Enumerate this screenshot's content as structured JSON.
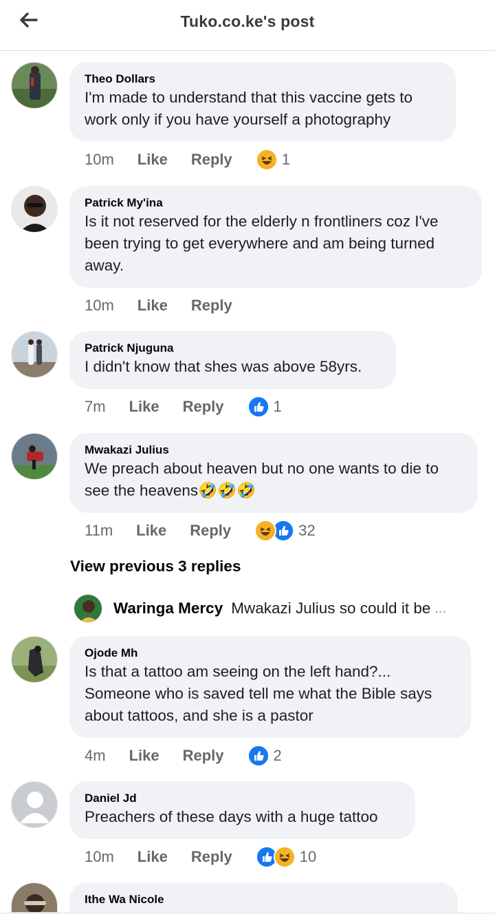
{
  "header": {
    "title": "Tuko.co.ke's post",
    "back_icon": "arrow-left-icon"
  },
  "comments": [
    {
      "author": "Theo Dollars",
      "lines": [
        "I'm made to understand that this vaccine gets to",
        "work only if you have yourself a photography"
      ],
      "time": "10m",
      "like": "Like",
      "reply": "Reply",
      "reactions": [
        "laughing-face-icon"
      ],
      "reaction_count": "1"
    },
    {
      "author": "Patrick My'ina",
      "lines": [
        "Is it not reserved for the elderly n frontliners coz I've",
        "been trying to get everywhere and am being turned",
        "away."
      ],
      "time": "10m",
      "like": "Like",
      "reply": "Reply",
      "reactions": [],
      "reaction_count": ""
    },
    {
      "author": "Patrick Njuguna",
      "lines": [
        "I didn't know that shes was above 58yrs."
      ],
      "time": "7m",
      "like": "Like",
      "reply": "Reply",
      "reactions": [
        "thumbs-up-icon"
      ],
      "reaction_count": "1"
    },
    {
      "author": "Mwakazi Julius",
      "lines": [
        "We preach about heaven but no one wants to die to",
        "see the heavens🤣🤣🤣"
      ],
      "time": "11m",
      "like": "Like",
      "reply": "Reply",
      "reactions": [
        "laughing-face-icon",
        "thumbs-up-icon"
      ],
      "reaction_count": "32"
    },
    {
      "author": "Ojode Mh",
      "lines": [
        "Is that a tattoo am seeing on the left hand?...",
        "Someone who is saved tell me what the Bible says",
        "about tattoos, and she is a pastor"
      ],
      "time": "4m",
      "like": "Like",
      "reply": "Reply",
      "reactions": [
        "thumbs-up-icon"
      ],
      "reaction_count": "2"
    },
    {
      "author": "Daniel Jd",
      "lines": [
        "Preachers of these days with a huge tattoo"
      ],
      "time": "10m",
      "like": "Like",
      "reply": "Reply",
      "reactions": [
        "thumbs-up-icon",
        "laughing-face-icon"
      ],
      "reaction_count": "10"
    },
    {
      "author": "Ithe Wa Nicole",
      "lines": [
        ""
      ],
      "time": "",
      "like": "",
      "reply": "",
      "reactions": [],
      "reaction_count": ""
    }
  ],
  "view_previous_replies": "View previous 3 replies",
  "reply_preview": {
    "author": "Waringa Mercy",
    "text": "Mwakazi Julius so could it be",
    "ellipsis": "..."
  },
  "colors": {
    "bubble": "#f0f2f5",
    "like_blue": "#1877f2",
    "haha_yellow": "#f7b125",
    "meta_grey": "#65676b"
  }
}
